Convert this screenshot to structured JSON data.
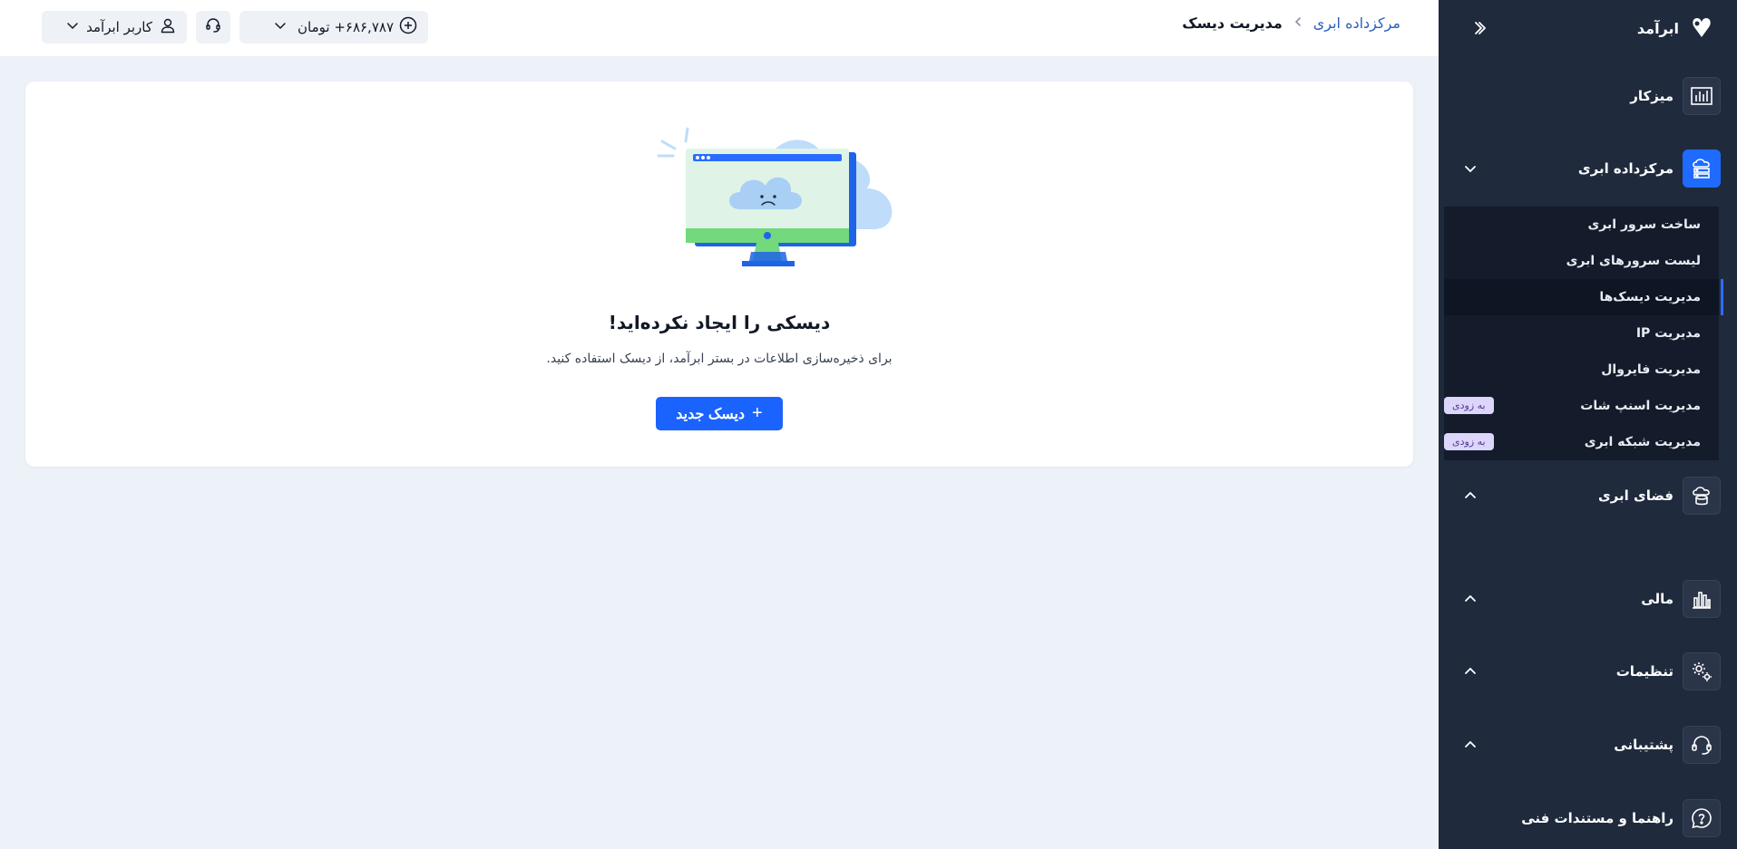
{
  "brand": {
    "name": "ابرآمد"
  },
  "topbar": {
    "breadcrumb": {
      "parent": "مرکزداده ابری",
      "current": "مدیریت دیسک"
    },
    "wallet": {
      "amount": "۶۸۶,۷۸۷+ تومان"
    },
    "user": {
      "name": "کاربر ابرآمد"
    }
  },
  "sidebar": {
    "items": [
      {
        "label": "میزکار",
        "icon": "chart-icon"
      },
      {
        "label": "مرکزداده ابری",
        "icon": "server-cloud-icon",
        "active": true
      },
      {
        "label": "فضای ابری",
        "icon": "cloud-storage-icon"
      },
      {
        "label": "مالی",
        "icon": "finance-chart-icon"
      },
      {
        "label": "تنظیمات",
        "icon": "gear-icon"
      },
      {
        "label": "پشتیبانی",
        "icon": "headset-icon"
      },
      {
        "label": "راهنما و مستندات فنی",
        "icon": "help-icon"
      }
    ],
    "submenu": [
      {
        "label": "ساخت سرور ابری"
      },
      {
        "label": "لیست سرورهای ابری"
      },
      {
        "label": "مدیریت دیسک‌ها",
        "active": true
      },
      {
        "label": "مدیریت IP"
      },
      {
        "label": "مدیریت فایروال"
      },
      {
        "label": "مدیریت اسنپ شات",
        "badge": "به زودی"
      },
      {
        "label": "مدیریت شبکه ابری",
        "badge": "به زودی"
      }
    ]
  },
  "main": {
    "empty_title": "دیسکی را ایجاد نکرده‌اید!",
    "empty_desc": "برای ذخیره‌سازی اطلاعات در بستر ابرآمد، از دیسک استفاده کنید.",
    "new_button": "دیسک جدید",
    "new_button_icon": "+"
  },
  "colors": {
    "sidebar_bg": "#1f2a3d",
    "accent": "#1a63ff",
    "page_bg": "#edf1f8",
    "badge_bg": "#ddd6fb"
  }
}
